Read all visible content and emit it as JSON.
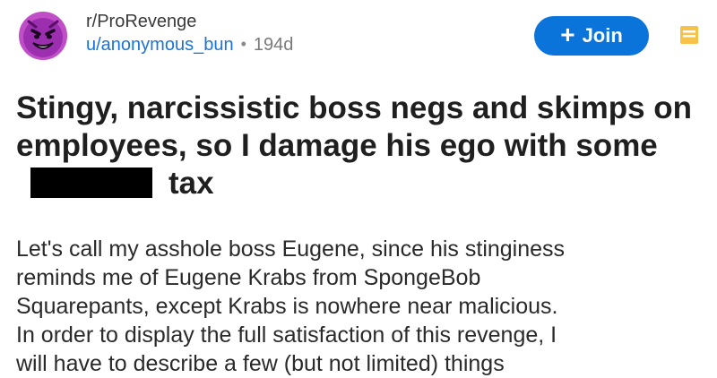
{
  "header": {
    "subreddit": "r/ProRevenge",
    "username": "u/anonymous_bun",
    "separator": "•",
    "age": "194d",
    "join_label": "Join",
    "plus_glyph": "+"
  },
  "icons": {
    "avatar": "angry-face-avatar-icon",
    "tool": "save-icon"
  },
  "post": {
    "title_part1": "Stingy, narcissistic boss negs and skimps on employees, so I damage his ego with some",
    "title_part2": "tax",
    "body_lines": [
      "Let's call my asshole boss Eugene, since his stinginess",
      "reminds me of Eugene Krabs from SpongeBob",
      "Squarepants, except Krabs is nowhere near malicious.",
      "In order to display the full satisfaction of this revenge, I",
      "will have to describe a few (but not limited) things"
    ]
  },
  "colors": {
    "join_bg": "#0b74db",
    "link": "#1a73d9",
    "avatar_purple": "#b24ec0"
  }
}
